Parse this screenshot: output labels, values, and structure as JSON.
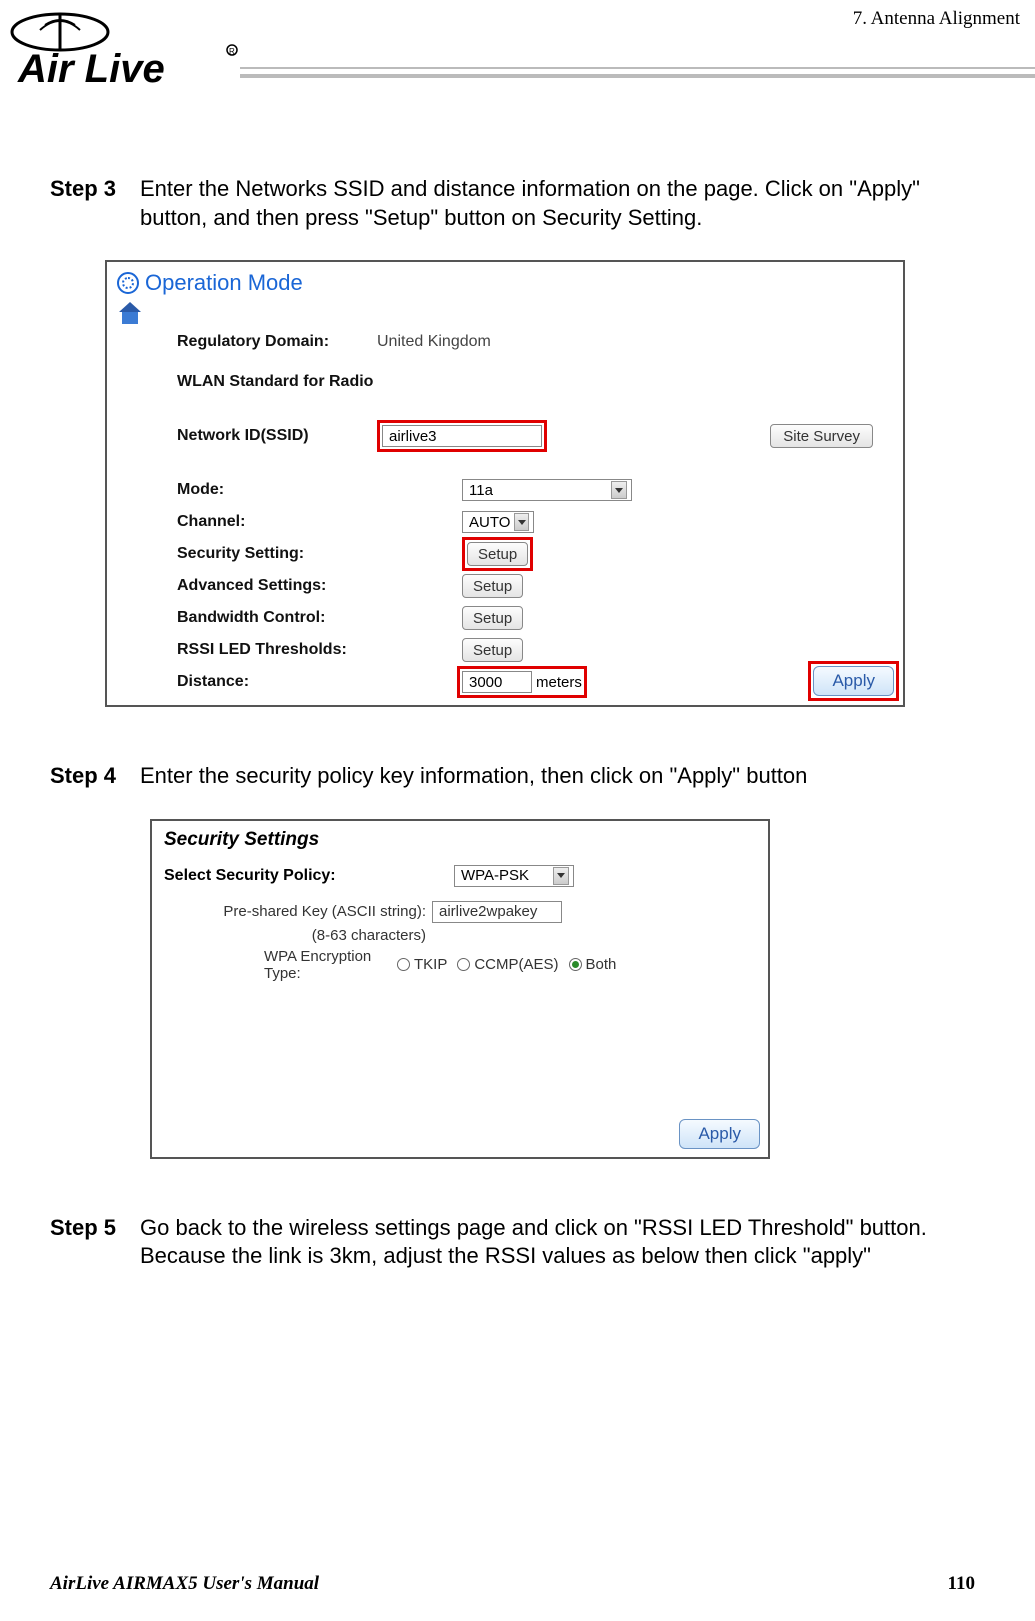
{
  "header": {
    "chapter": "7.  Antenna  Alignment",
    "logo_alt": "Air Live"
  },
  "steps": {
    "s3": {
      "label": "Step 3",
      "text": "Enter the Networks SSID and distance information on the page.    Click on \"Apply\" button, and then press \"Setup\" button on Security Setting."
    },
    "s4": {
      "label": "Step 4",
      "text": "Enter the security policy key information, then click on \"Apply\" button"
    },
    "s5": {
      "label": "Step 5",
      "text": "Go back to the wireless settings page and click on \"RSSI LED Threshold\" button. Because the link is 3km, adjust the RSSI values as below then click \"apply\""
    }
  },
  "panel1": {
    "operation_mode": "Operation Mode",
    "reg_domain_label": "Regulatory Domain:",
    "reg_domain_value": "United Kingdom",
    "wlan_std_label": "WLAN Standard for Radio",
    "ssid_label": "Network ID(SSID)",
    "ssid_value": "airlive3",
    "site_survey": "Site Survey",
    "mode_label": "Mode:",
    "mode_value": "11a",
    "channel_label": "Channel:",
    "channel_value": "AUTO",
    "security_label": "Security Setting:",
    "advanced_label": "Advanced Settings:",
    "bandwidth_label": "Bandwidth Control:",
    "rssi_label": "RSSI LED Thresholds:",
    "setup_btn": "Setup",
    "distance_label": "Distance:",
    "distance_value": "3000",
    "distance_unit": "meters",
    "apply": "Apply"
  },
  "panel2": {
    "title": "Security Settings",
    "policy_label": "Select Security Policy:",
    "policy_value": "WPA-PSK",
    "psk_label1": "Pre-shared Key (ASCII string):",
    "psk_label2": "(8-63 characters)",
    "psk_value": "airlive2wpakey",
    "enc_label": "WPA Encryption Type:",
    "enc_opt1": "TKIP",
    "enc_opt2": "CCMP(AES)",
    "enc_opt3": "Both",
    "apply": "Apply"
  },
  "footer": {
    "left": "AirLive AIRMAX5 User's Manual",
    "page": "110"
  }
}
